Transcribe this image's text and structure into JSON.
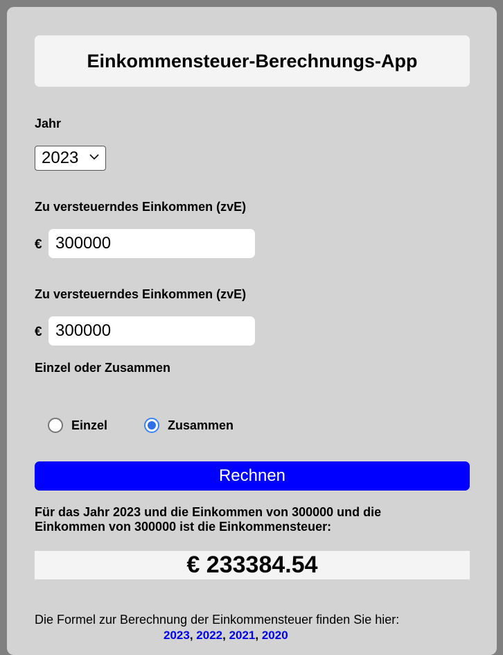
{
  "app": {
    "title": "Einkommensteuer-Berechnungs-App"
  },
  "year": {
    "label": "Jahr",
    "selected": "2023"
  },
  "income1": {
    "label": "Zu versteuerndes Einkommen (zvE)",
    "currency": "€",
    "value": "300000"
  },
  "income2": {
    "label": "Zu versteuerndes Einkommen (zvE)",
    "currency": "€",
    "value": "300000"
  },
  "filing": {
    "label": "Einzel oder Zusammen",
    "options": [
      "Einzel",
      "Zusammen"
    ],
    "selected": "Zusammen"
  },
  "actions": {
    "calculate_label": "Rechnen"
  },
  "result": {
    "description": "Für das Jahr 2023 und die Einkommen von 300000 und die Einkommen von 300000 ist die Einkommensteuer:",
    "amount": "€ 233384.54"
  },
  "formula": {
    "text": "Die Formel zur Berechnung der Einkommensteuer finden Sie hier:",
    "links": [
      "2023",
      "2022",
      "2021",
      "2020"
    ],
    "separator": ", "
  },
  "colors": {
    "button": "#0000ff",
    "link": "#0000ee",
    "panel": "#d3d3d3"
  }
}
